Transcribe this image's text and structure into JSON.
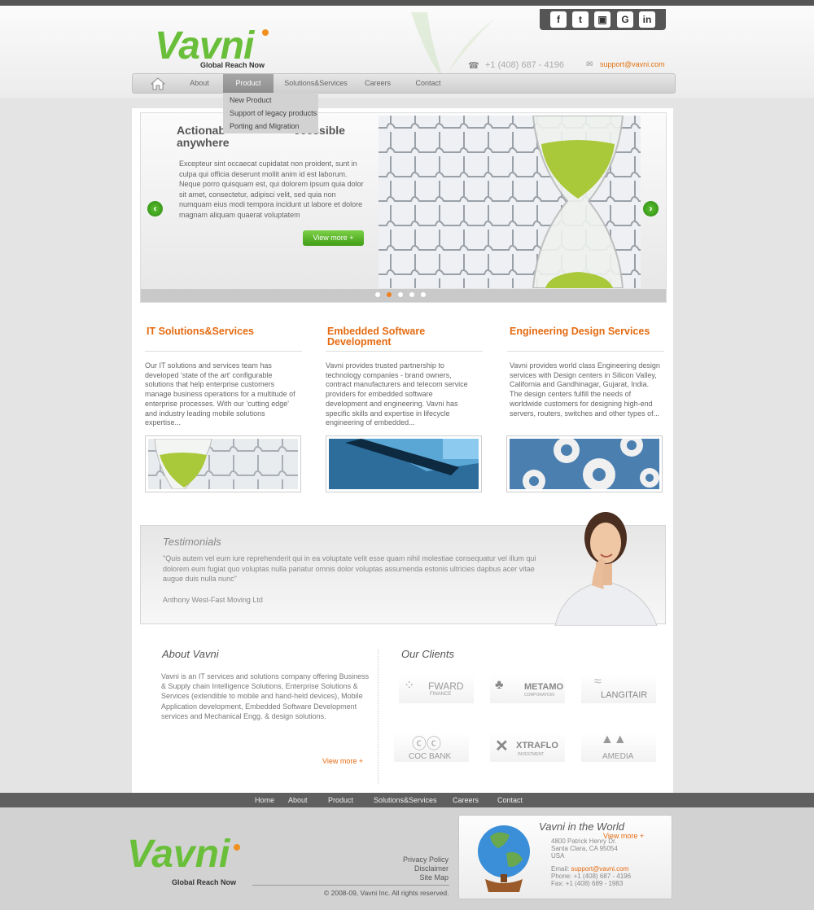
{
  "brand": {
    "logo_text": "Vavni",
    "tagline": "Global Reach Now"
  },
  "social": [
    "f",
    "t",
    "▣",
    "G",
    "in"
  ],
  "contact": {
    "phone": "+1 (408) 687 - 4196",
    "email": "support@vavni.com"
  },
  "nav": {
    "items": [
      "About",
      "Product",
      "Solutions&Services",
      "Careers",
      "Contact"
    ],
    "active": "Product"
  },
  "dropdown": [
    "New Product",
    "Support of legacy products",
    "Porting and Migration"
  ],
  "slider": {
    "title": "Actionable ... Accessible anywhere",
    "title_left": "Actionab",
    "title_right": "ccessible",
    "title_line2": "anywhere",
    "text": "Excepteur sint occaecat cupidatat non proident, sunt in culpa qui officia deserunt mollit anim id est laborum. Neque porro quisquam est, qui dolorem ipsum quia dolor sit amet, consectetur, adipisci velit, sed quia non numquam eius modi tempora incidunt ut labore et dolore magnam aliquam quaerat voluptatem",
    "button": "View more +",
    "prev": "‹",
    "next": "›",
    "active_dot": 1,
    "dot_count": 5
  },
  "columns": [
    {
      "title": "IT Solutions&Services",
      "text": "Our IT solutions and services team has developed 'state of the art' configurable solutions that help enterprise customers manage business operations for a multitude of enterprise processes. With our 'cutting edge' and industry leading mobile solutions expertise..."
    },
    {
      "title": "Embedded Software Development",
      "text": "Vavni provides trusted partnership to technology companies - brand owners, contract manufacturers and telecom service providers for embedded software development and engineering. Vavni has specific skills and expertise in lifecycle engineering of embedded..."
    },
    {
      "title": "Engineering Design Services",
      "text": "Vavni provides world class Engineering design services with Design centers in Silicon Valley, California and Gandhinagar, Gujarat, India. The design centers fulfill the needs of worldwide customers for designing high-end servers, routers, switches and other types of..."
    }
  ],
  "testimonials": {
    "title": "Testimonials",
    "quote": "\"Quis autem vel eum iure reprehenderit qui in ea voluptate velit esse quam nihil molestiae consequatur vel illum qui dolorem eum fugiat quo voluptas nulla pariatur omnis dolor voluptas assumenda estonis ultricies dapbus acer vitae augue duis nulla nunc\"",
    "author": "Anthony West-Fast Moving Ltd"
  },
  "about": {
    "title": "About Vavni",
    "text": "Vavni is an IT services and solutions company offering Business & Supply chain Intelligence Solutions, Enterprise Solutions & Services (extendible to mobile and hand-held devices), Mobile Application development, Embedded Software Development services and Mechanical Engg. & design solutions.",
    "more": "View more +"
  },
  "clients": {
    "title": "Our Clients",
    "logos": [
      {
        "name": "FWARD",
        "sub": "FINANCE"
      },
      {
        "name": "METAMO",
        "sub": "CORPORATION"
      },
      {
        "name": "LANGITAIR",
        "sub": ""
      },
      {
        "name": "COC BANK",
        "sub": ""
      },
      {
        "name": "XTRAFLO",
        "sub": "INVESTMENT"
      },
      {
        "name": "AMEDIA",
        "sub": ""
      }
    ]
  },
  "footer_nav": [
    "Home",
    "About",
    "Product",
    "Solutions&Services",
    "Careers",
    "Contact"
  ],
  "footer": {
    "links": [
      "Privacy Policy",
      "Disclaimer",
      "Site Map"
    ],
    "copyright": "© 2008-09, Vavni Inc. All rights reserved.",
    "world": {
      "title": "Vavni in the World",
      "more": "View more +",
      "address": [
        "4800 Patrick Henry Dr.",
        "Santa Clara, CA 95054",
        "USA"
      ],
      "email_label": "Email:",
      "email": "support@vavni.com",
      "phone": "Phone: +1 (408) 687 - 4196",
      "fax": "Fax: +1 (408) 689 - 1983"
    }
  },
  "colors": {
    "accent_orange": "#e56a10",
    "brand_green": "#6abf3a",
    "dark_bar": "#555555"
  }
}
